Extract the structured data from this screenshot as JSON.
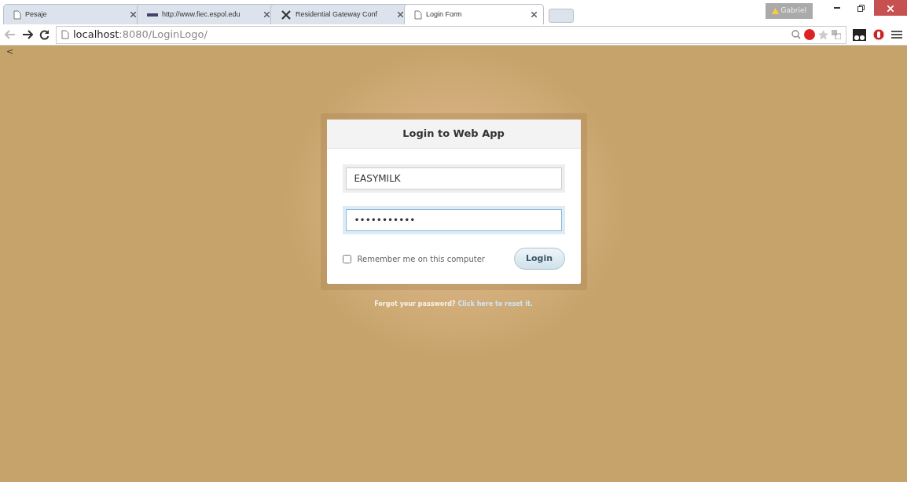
{
  "tabs": [
    {
      "title": "Pesaje",
      "kind": "page",
      "selected": false
    },
    {
      "title": "http://www.fiec.espol.edu",
      "kind": "site",
      "selected": false
    },
    {
      "title": "Residential Gateway Conf",
      "kind": "tools",
      "selected": false
    },
    {
      "title": "Login Form",
      "kind": "page",
      "selected": true
    }
  ],
  "profile": {
    "name": "Gabriel"
  },
  "address": {
    "host": "localhost",
    "path": ":8080/LoginLogo/"
  },
  "page": {
    "corner_text": "<",
    "form": {
      "title": "Login to Web App",
      "username": "EASYMILK",
      "password": "•••••••••••",
      "password_focused": true,
      "remember": {
        "label": "Remember me on this computer",
        "checked": false
      },
      "button": "Login"
    },
    "forgot": {
      "text": "Forgot your password?",
      "link": "Click here to reset it."
    }
  }
}
